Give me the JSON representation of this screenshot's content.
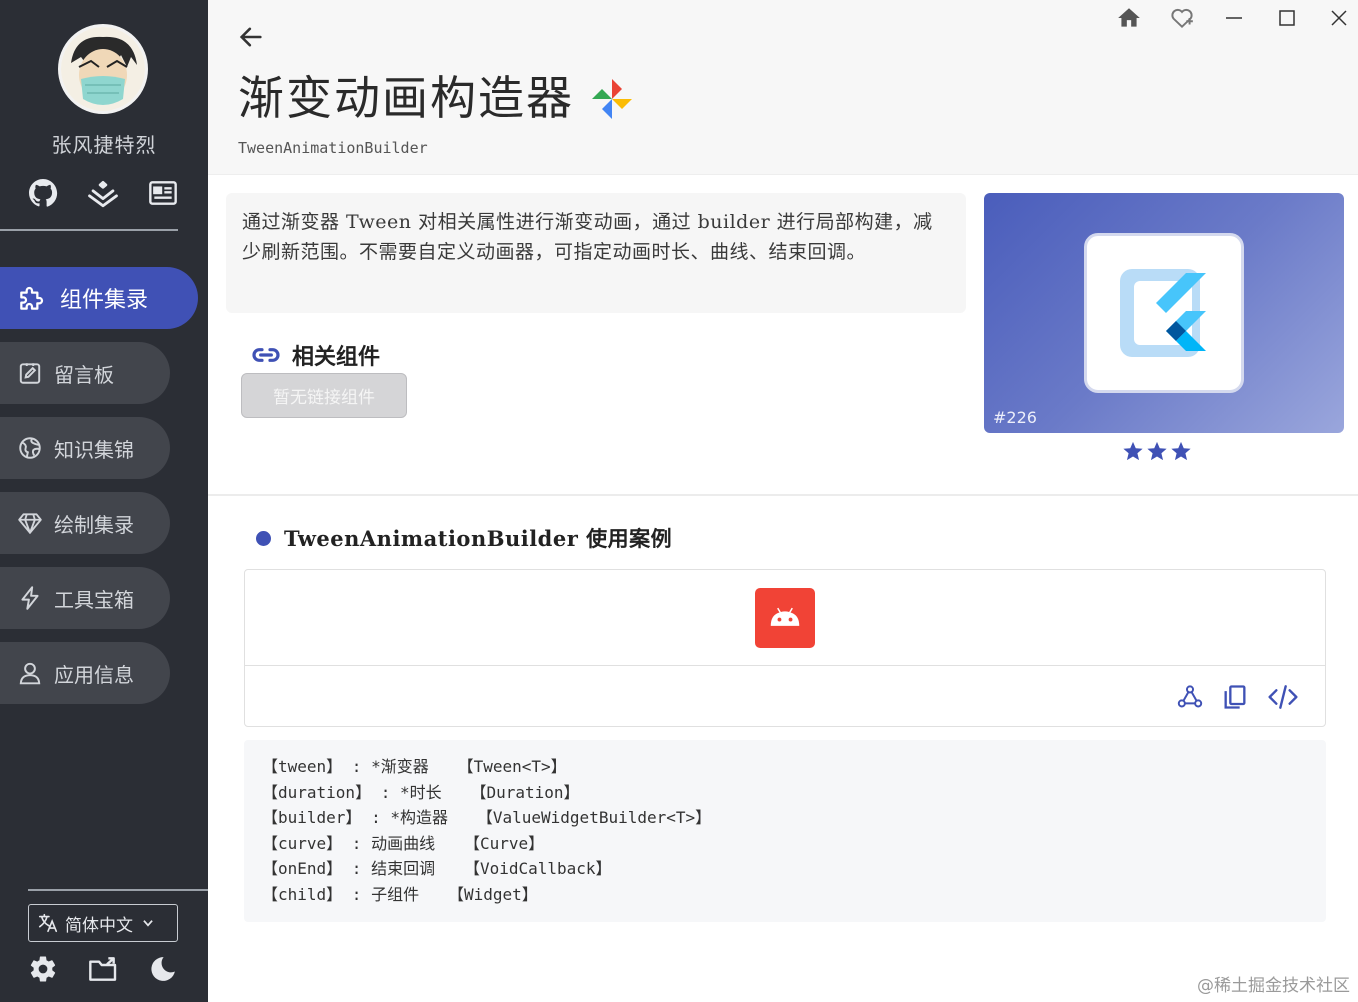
{
  "sidebar": {
    "username": "张风捷特烈",
    "social_icons": [
      "github-icon",
      "juejin-icon",
      "profile-card-icon"
    ],
    "nav_items": [
      {
        "label": "组件集录",
        "icon": "puzzle-icon",
        "active": true
      },
      {
        "label": "留言板",
        "icon": "edit-note-icon",
        "active": false
      },
      {
        "label": "知识集锦",
        "icon": "globe-icon",
        "active": false
      },
      {
        "label": "绘制集录",
        "icon": "diamond-icon",
        "active": false
      },
      {
        "label": "工具宝箱",
        "icon": "lightning-icon",
        "active": false
      },
      {
        "label": "应用信息",
        "icon": "person-icon",
        "active": false
      }
    ],
    "language": "简体中文",
    "bottom_icons": [
      "settings-icon",
      "folder-icon",
      "dark-mode-icon"
    ]
  },
  "header": {
    "title": "渐变动画构造器",
    "subtitle": "TweenAnimationBuilder",
    "window_buttons": [
      "home-icon",
      "favorite-icon",
      "minimize-icon",
      "maximize-icon",
      "close-icon"
    ]
  },
  "description": "通过渐变器 Tween 对相关属性进行渐变动画，通过 builder 进行局部构建，减少刷新范围。不需要自定义动画器，可指定动画时长、曲线、结束回调。",
  "related": {
    "title": "相关组件",
    "empty_button": "暂无链接组件"
  },
  "hero": {
    "id": "#226",
    "stars": 3
  },
  "case": {
    "title": "TweenAnimationBuilder 使用案例",
    "actions": [
      "share-icon",
      "copy-icon",
      "code-icon"
    ]
  },
  "params": [
    "【tween】 : *渐变器   【Tween<T>】",
    "【duration】 : *时长   【Duration】",
    "【builder】 : *构造器   【ValueWidgetBuilder<T>】",
    "【curve】 : 动画曲线   【Curve】",
    "【onEnd】 : 结束回调   【VoidCallback】",
    "【child】 : 子组件   【Widget】"
  ],
  "watermark": "@稀土掘金技术社区",
  "colors": {
    "sidebar_bg": "#2b2e35",
    "accent": "#3f51b5",
    "android_red": "#f14336"
  }
}
